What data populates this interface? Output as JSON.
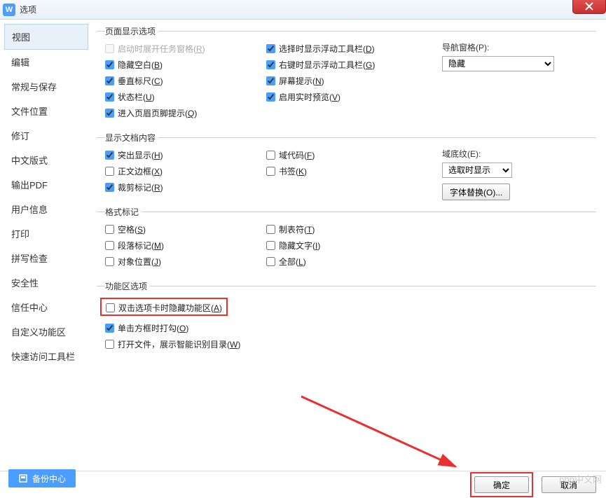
{
  "titlebar": {
    "title": "选项",
    "icon_text": "W"
  },
  "sidebar": {
    "items": [
      "视图",
      "编辑",
      "常规与保存",
      "文件位置",
      "修订",
      "中文版式",
      "输出PDF",
      "用户信息",
      "打印",
      "拼写检查",
      "安全性",
      "信任中心",
      "自定义功能区",
      "快速访问工具栏"
    ],
    "active_index": 0
  },
  "section1": {
    "legend": "页面显示选项",
    "left": [
      {
        "label": "启动时展开任务窗格(R)",
        "checked": false,
        "disabled": true
      },
      {
        "label": "隐藏空白(B)",
        "checked": true
      },
      {
        "label": "垂直标尺(C)",
        "checked": true
      },
      {
        "label": "状态栏(U)",
        "checked": true
      },
      {
        "label": "进入页眉页脚提示(Q)",
        "checked": true
      }
    ],
    "right": [
      {
        "label": "选择时显示浮动工具栏(D)",
        "checked": true
      },
      {
        "label": "右键时显示浮动工具栏(G)",
        "checked": true
      },
      {
        "label": "屏幕提示(N)",
        "checked": true
      },
      {
        "label": "启用实时预览(V)",
        "checked": true
      }
    ],
    "nav_label": "导航窗格(P):",
    "nav_value": "隐藏"
  },
  "section2": {
    "legend": "显示文档内容",
    "left": [
      {
        "label": "突出显示(H)",
        "checked": true
      },
      {
        "label": "正文边框(X)",
        "checked": false
      },
      {
        "label": "裁剪标记(R)",
        "checked": true
      }
    ],
    "right": [
      {
        "label": "域代码(F)",
        "checked": false
      },
      {
        "label": "书签(K)",
        "checked": false
      }
    ],
    "shading_label": "域底纹(E):",
    "shading_value": "选取时显示",
    "font_sub_btn": "字体替换(O)..."
  },
  "section3": {
    "legend": "格式标记",
    "left": [
      {
        "label": "空格(S)",
        "checked": false
      },
      {
        "label": "段落标记(M)",
        "checked": false
      },
      {
        "label": "对象位置(J)",
        "checked": false
      }
    ],
    "right": [
      {
        "label": "制表符(T)",
        "checked": false
      },
      {
        "label": "隐藏文字(I)",
        "checked": false
      },
      {
        "label": "全部(L)",
        "checked": false
      }
    ]
  },
  "section4": {
    "legend": "功能区选项",
    "items": [
      {
        "label": "双击选项卡时隐藏功能区(A)",
        "checked": false,
        "highlighted": true
      },
      {
        "label": "单击方框时打勾(O)",
        "checked": true
      },
      {
        "label": "打开文件，展示智能识别目录(W)",
        "checked": false,
        "blue": true
      }
    ]
  },
  "footer": {
    "backup": "备份中心",
    "ok": "确定",
    "cancel": "取消"
  },
  "watermark": "php中文网"
}
